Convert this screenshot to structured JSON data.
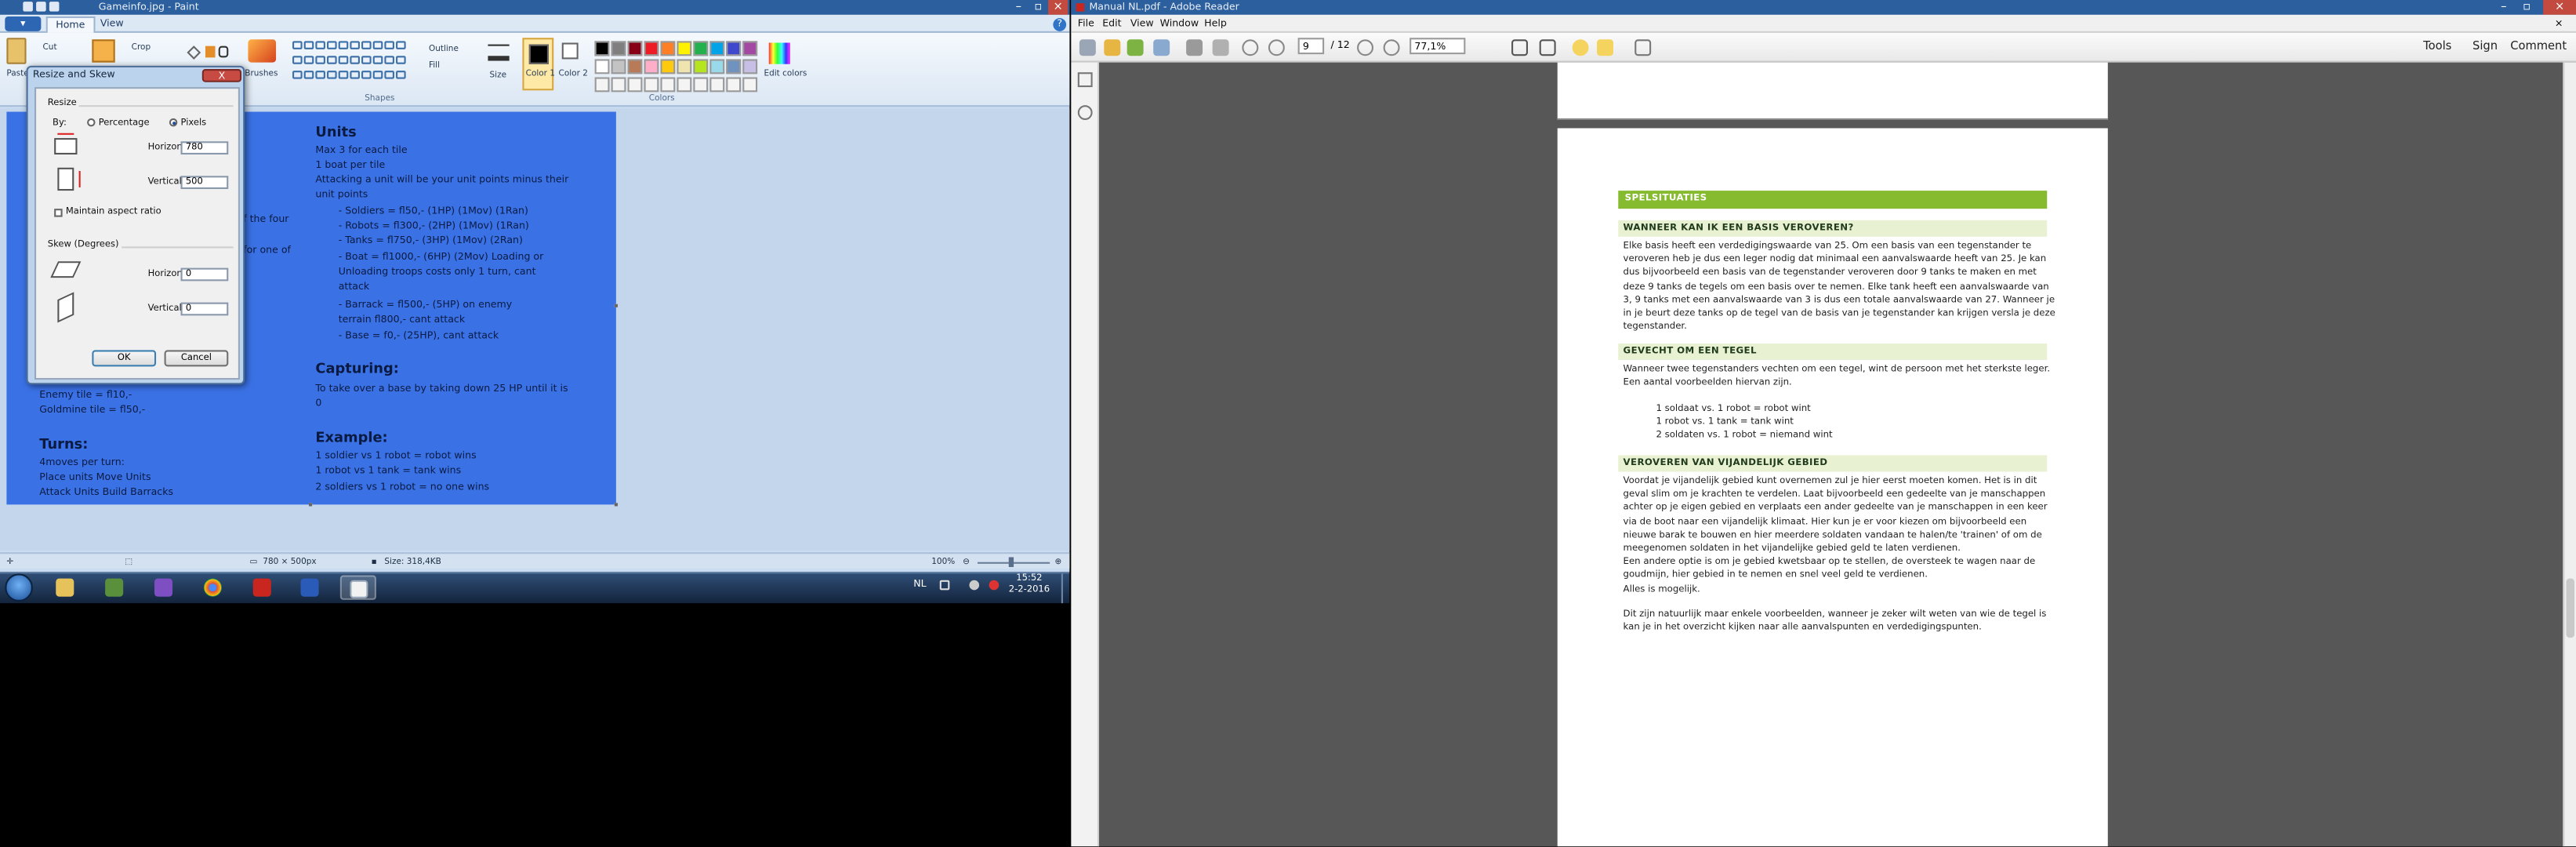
{
  "paint": {
    "title": "Gameinfo.jpg - Paint",
    "file_button": "▾",
    "tabs": [
      "Home",
      "View"
    ],
    "clipboard": {
      "paste": "Paste",
      "cut": "Cut",
      "crop": "Crop"
    },
    "labels": {
      "brushes": "Brushes",
      "outline": "Outline",
      "fill": "Fill",
      "size": "Size",
      "shapes": "Shapes",
      "colors": "Colors",
      "color1": "Color 1",
      "color2": "Color 2",
      "edit_colors": "Edit colors"
    },
    "canvas": {
      "left_partial": [
        "f the four",
        "for one of",
        "Enemy tile = fl10,-",
        "Goldmine tile = fl50,-"
      ],
      "turns_heading": "Turns:",
      "turns_lines": [
        "4moves per turn:",
        "Place units    Move Units",
        "Attack Units  Build Barracks"
      ],
      "units_heading": "Units",
      "units_lines": [
        "Max 3 for each tile",
        "1 boat per tile",
        "Attacking a unit will be your unit points minus their",
        "unit points"
      ],
      "unit_items": [
        "-        Soldiers = fl50,- (1HP) (1Mov) (1Ran)",
        "-        Robots = fl300,- (2HP) (1Mov) (1Ran)",
        "-        Tanks = fl750,- (3HP) (1Mov) (2Ran)",
        "-        Boat = fl1000,- (6HP) (2Mov) Loading or",
        "          Unloading troops costs only 1 turn, cant",
        "          attack",
        "-        Barrack = fl500,- (5HP) on enemy",
        "          terrain fl800,- cant attack",
        "-        Base = f0,- (25HP), cant attack"
      ],
      "capturing_heading": "Capturing:",
      "capturing_lines": [
        "To take over a base by taking down 25 HP until it is",
        "0"
      ],
      "example_heading": "Example:",
      "example_lines": [
        "1 soldier vs 1 robot = robot wins",
        "1 robot vs 1 tank = tank wins",
        "2 soldiers vs 1 robot = no one wins"
      ]
    },
    "status": {
      "dimensions": "780 × 500px",
      "size": "Size: 318,4KB",
      "zoom": "100%"
    }
  },
  "dialog": {
    "title": "Resize and Skew",
    "close": "X",
    "resize_label": "Resize",
    "by_label": "By:",
    "percentage": "Percentage",
    "pixels": "Pixels",
    "horizontal": "Horizontal:",
    "vertical": "Vertical:",
    "resize_h": "780",
    "resize_v": "500",
    "maintain": "Maintain aspect ratio",
    "skew_label": "Skew (Degrees)",
    "skew_h": "0",
    "skew_v": "0",
    "ok": "OK",
    "cancel": "Cancel"
  },
  "taskbar": {
    "lang": "NL",
    "time": "15:52",
    "date": "2-2-2016"
  },
  "reader": {
    "title": "Manual NL.pdf - Adobe Reader",
    "menu": [
      "File",
      "Edit",
      "View",
      "Window",
      "Help"
    ],
    "page_current": "9",
    "page_total": "/ 12",
    "zoom": "77,1%",
    "links": [
      "Tools",
      "Sign",
      "Comment"
    ],
    "doc": {
      "section": "SPELSITUATIES",
      "h1": "WANNEER KAN IK EEN BASIS VEROVEREN?",
      "p1": [
        "Elke basis heeft een verdedigingswaarde van 25. Om een basis van een tegenstander te",
        "veroveren heb je dus een leger nodig dat minimaal een aanvalswaarde heeft van 25. Je kan",
        "dus bijvoorbeeld een basis van de tegenstander veroveren door 9 tanks te maken en met",
        "deze 9 tanks de tegels om een basis over te nemen. Elke tank heeft een aanvalswaarde van",
        "3, 9 tanks met een aanvalswaarde van 3 is dus een totale aanvalswaarde van 27. Wanneer je",
        "in je beurt deze tanks op de tegel van de basis van je tegenstander kan krijgen versla je deze",
        "tegenstander."
      ],
      "h2": "GEVECHT OM EEN TEGEL",
      "p2": [
        "Wanneer twee tegenstanders vechten om een tegel, wint de persoon met het sterkste leger.",
        "Een aantal voorbeelden hiervan zijn."
      ],
      "examples": [
        "1 soldaat vs. 1 robot = robot wint",
        "1 robot vs. 1 tank = tank wint",
        "2 soldaten vs. 1 robot = niemand wint"
      ],
      "h3": "VEROVEREN VAN VIJANDELIJK GEBIED",
      "p3": [
        "Voordat je vijandelijk gebied kunt overnemen zul je hier eerst moeten komen. Het is in dit",
        "geval slim om je krachten te verdelen. Laat bijvoorbeeld een gedeelte van je manschappen",
        "achter op je eigen gebied en verplaats een ander gedeelte van je manschappen in een keer",
        "via de boot naar een vijandelijk klimaat. Hier kun je er voor kiezen om bijvoorbeeld een",
        "nieuwe barak te bouwen en hier meerdere soldaten vandaan te halen/te 'trainen' of om de",
        "meegenomen soldaten in het vijandelijke gebied geld te laten verdienen.",
        "Een andere optie is om je gebied kwetsbaar op te stellen, de oversteek te wagen naar de",
        "goudmijn, hier gebied in te nemen en snel veel geld te verdienen.",
        "Alles is mogelijk."
      ],
      "p4": [
        "Dit zijn natuurlijk maar enkele voorbeelden, wanneer je zeker wilt weten van wie de tegel is",
        "kan je in het overzicht kijken naar alle aanvalspunten en verdedigingspunten."
      ]
    }
  },
  "colors": {
    "canvas_bg": "#3a72e6",
    "paint_title": "#2b5f9e",
    "doc_green": "#86bb2f",
    "doc_band": "#e8f1d2",
    "reader_bg": "#575757",
    "palette": [
      "#000000",
      "#7f7f7f",
      "#880015",
      "#ed1c24",
      "#ff7f27",
      "#fff200",
      "#22b14c",
      "#00a2e8",
      "#3f48cc",
      "#a349a4",
      "#ffffff",
      "#c3c3c3",
      "#b97a57",
      "#ffaec9",
      "#ffc90e",
      "#efe4b0",
      "#b5e61d",
      "#99d9ea",
      "#7092be",
      "#c8bfe7"
    ]
  }
}
